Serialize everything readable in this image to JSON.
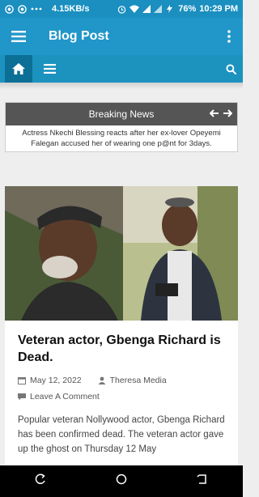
{
  "status_bar": {
    "speed": "4.15KB/s",
    "battery": "76%",
    "time": "10:29 PM"
  },
  "app_bar": {
    "title": "Blog Post"
  },
  "breaking": {
    "heading": "Breaking News",
    "headline": "Actress Nkechi Blessing reacts after her ex-lover Opeyemi Falegan accused her of wearing one p@nt for 3days."
  },
  "post": {
    "title": "Veteran actor, Gbenga Richard is Dead.",
    "date": "May 12, 2022",
    "author": "Theresa Media",
    "comment_label": "Leave A Comment",
    "excerpt": "Popular veteran Nollywood actor, Gbenga Richard has been confirmed dead. The veteran actor gave up the ghost on Thursday 12 May"
  },
  "colors": {
    "primary": "#2196c9",
    "nav": "#1c92bf",
    "nav_active": "#0c6f96"
  }
}
